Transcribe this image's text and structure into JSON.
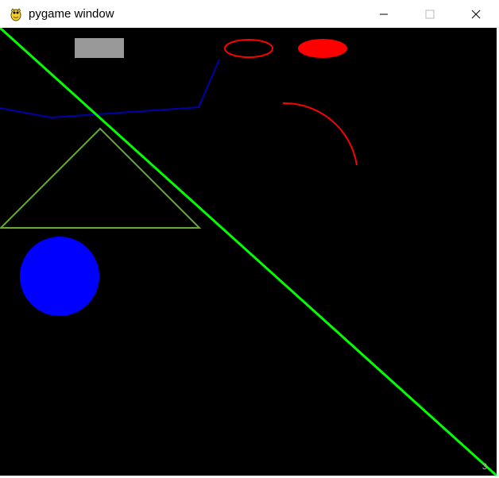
{
  "window": {
    "title": "pygame window",
    "app_icon": "pygame-snake-icon",
    "controls": {
      "minimize_icon": "minimize-icon",
      "maximize_icon": "maximize-icon",
      "close_icon": "close-icon"
    }
  },
  "canvas": {
    "background": "#000000",
    "corner_text": "3",
    "shapes": [
      {
        "kind": "filled-rectangle",
        "color": "#999999"
      },
      {
        "kind": "ellipse-outline",
        "color": "#ff0000"
      },
      {
        "kind": "filled-ellipse",
        "color": "#ff0000"
      },
      {
        "kind": "polyline",
        "color": "#0000aa"
      },
      {
        "kind": "arc",
        "color": "#ff0000"
      },
      {
        "kind": "triangle-outline",
        "color": "#66aa33"
      },
      {
        "kind": "filled-circle",
        "color": "#0000ff"
      },
      {
        "kind": "diagonal-line",
        "color": "#00ff00"
      }
    ]
  }
}
